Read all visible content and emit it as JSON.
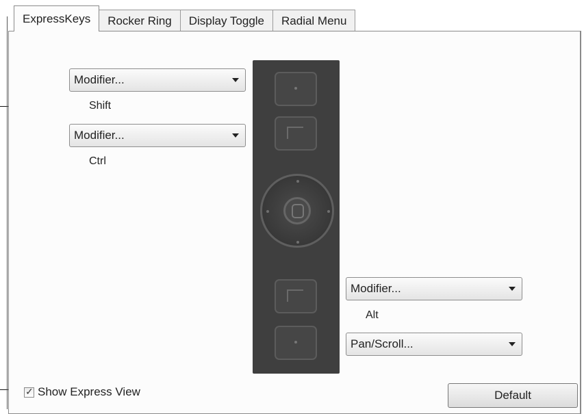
{
  "tabs": [
    {
      "label": "ExpressKeys",
      "active": true
    },
    {
      "label": "Rocker Ring",
      "active": false
    },
    {
      "label": "Display Toggle",
      "active": false
    },
    {
      "label": "Radial Menu",
      "active": false
    }
  ],
  "expresskeys": {
    "top_left_1": {
      "value": "Modifier...",
      "assigned": "Shift"
    },
    "top_left_2": {
      "value": "Modifier...",
      "assigned": "Ctrl"
    },
    "bottom_right_1": {
      "value": "Modifier...",
      "assigned": "Alt"
    },
    "bottom_right_2": {
      "value": "Pan/Scroll..."
    }
  },
  "show_express_view": {
    "label": "Show Express View",
    "checked": true
  },
  "default_button": {
    "label": "Default"
  },
  "icons": {
    "dropdown_arrow": "chevron-down-icon",
    "check": "checkmark-icon"
  },
  "colors": {
    "device_body": "#3f3f3f",
    "panel_bg": "#fcfcfc"
  }
}
